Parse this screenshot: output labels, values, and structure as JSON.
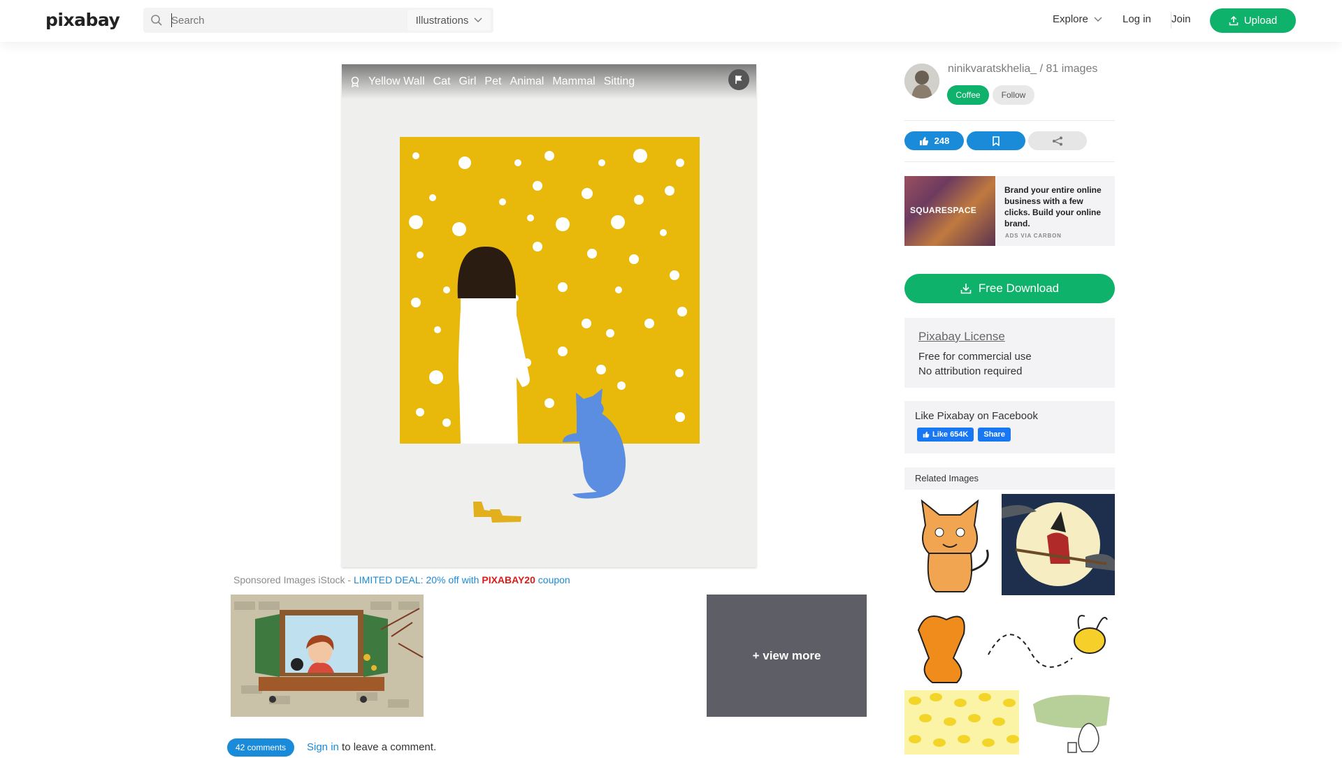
{
  "header": {
    "logo": "pixabay",
    "search_placeholder": "Search",
    "category": "Illustrations",
    "nav": {
      "explore": "Explore",
      "login": "Log in",
      "join": "Join",
      "upload": "Upload"
    }
  },
  "image": {
    "tags": [
      "Yellow Wall",
      "Cat",
      "Girl",
      "Pet",
      "Animal",
      "Mammal",
      "Sitting"
    ]
  },
  "sponsored": {
    "prefix": "Sponsored Images iStock - ",
    "deal": "LIMITED DEAL: 20% off with ",
    "code": "PIXABAY20",
    "suffix": " coupon",
    "view_more": "+ view more"
  },
  "comments": {
    "count_label": "42 comments",
    "sign_in": "Sign in",
    "leave": " to leave a comment."
  },
  "author": {
    "name": "ninikvaratskhelia_",
    "images": " / 81 images",
    "coffee": "Coffee",
    "follow": "Follow"
  },
  "actions": {
    "likes": "248"
  },
  "ad": {
    "brand": "SQUARESPACE",
    "text": "Brand your entire online business with a few clicks. Build your online brand.",
    "via": "ADS VIA CARBON"
  },
  "download": {
    "label": "Free Download"
  },
  "license": {
    "title": "Pixabay License",
    "lines": [
      "Free for commercial use",
      "No attribution required"
    ]
  },
  "facebook": {
    "title": "Like Pixabay on Facebook",
    "like": "Like 654K",
    "share": "Share"
  },
  "related": {
    "title": "Related Images"
  },
  "colors": {
    "green": "#0fb26a",
    "blue": "#1a8bd8",
    "wall": "#e8b80a",
    "cat": "#5b8de0"
  }
}
